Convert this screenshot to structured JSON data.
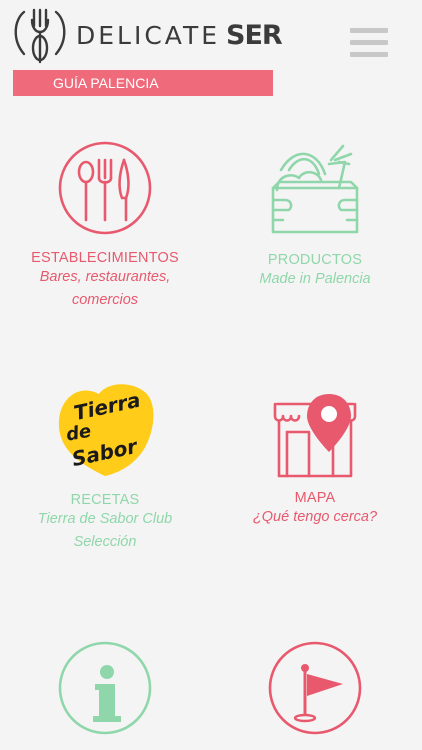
{
  "header": {
    "brand_left": "DELICATE",
    "brand_right": "SER",
    "guide_label": "GUÍA PALENCIA",
    "menu_icon": "hamburger-menu-icon"
  },
  "colors": {
    "accent_red": "#e8596e",
    "accent_green": "#8fd7aa",
    "bar_pink": "#ef6b7c",
    "background": "#f4f4f4"
  },
  "tiles": [
    {
      "icon": "cutlery-icon",
      "title": "ESTABLECIMIENTOS",
      "subtitle_1": "Bares, restaurantes,",
      "subtitle_2": "comercios"
    },
    {
      "icon": "vegetable-box-icon",
      "title": "PRODUCTOS",
      "subtitle_1": "Made in Palencia"
    },
    {
      "icon": "tierra-de-sabor-logo",
      "title": "RECETAS",
      "subtitle_1": "Tierra de Sabor Club",
      "subtitle_2": "Selección",
      "logo_text_1": "Tierra",
      "logo_text_2": "de",
      "logo_text_3": "Sabor"
    },
    {
      "icon": "map-store-pin-icon",
      "title": "MAPA",
      "subtitle_1": "¿Qué tengo cerca?"
    },
    {
      "icon": "info-icon"
    },
    {
      "icon": "golf-flag-icon"
    }
  ]
}
